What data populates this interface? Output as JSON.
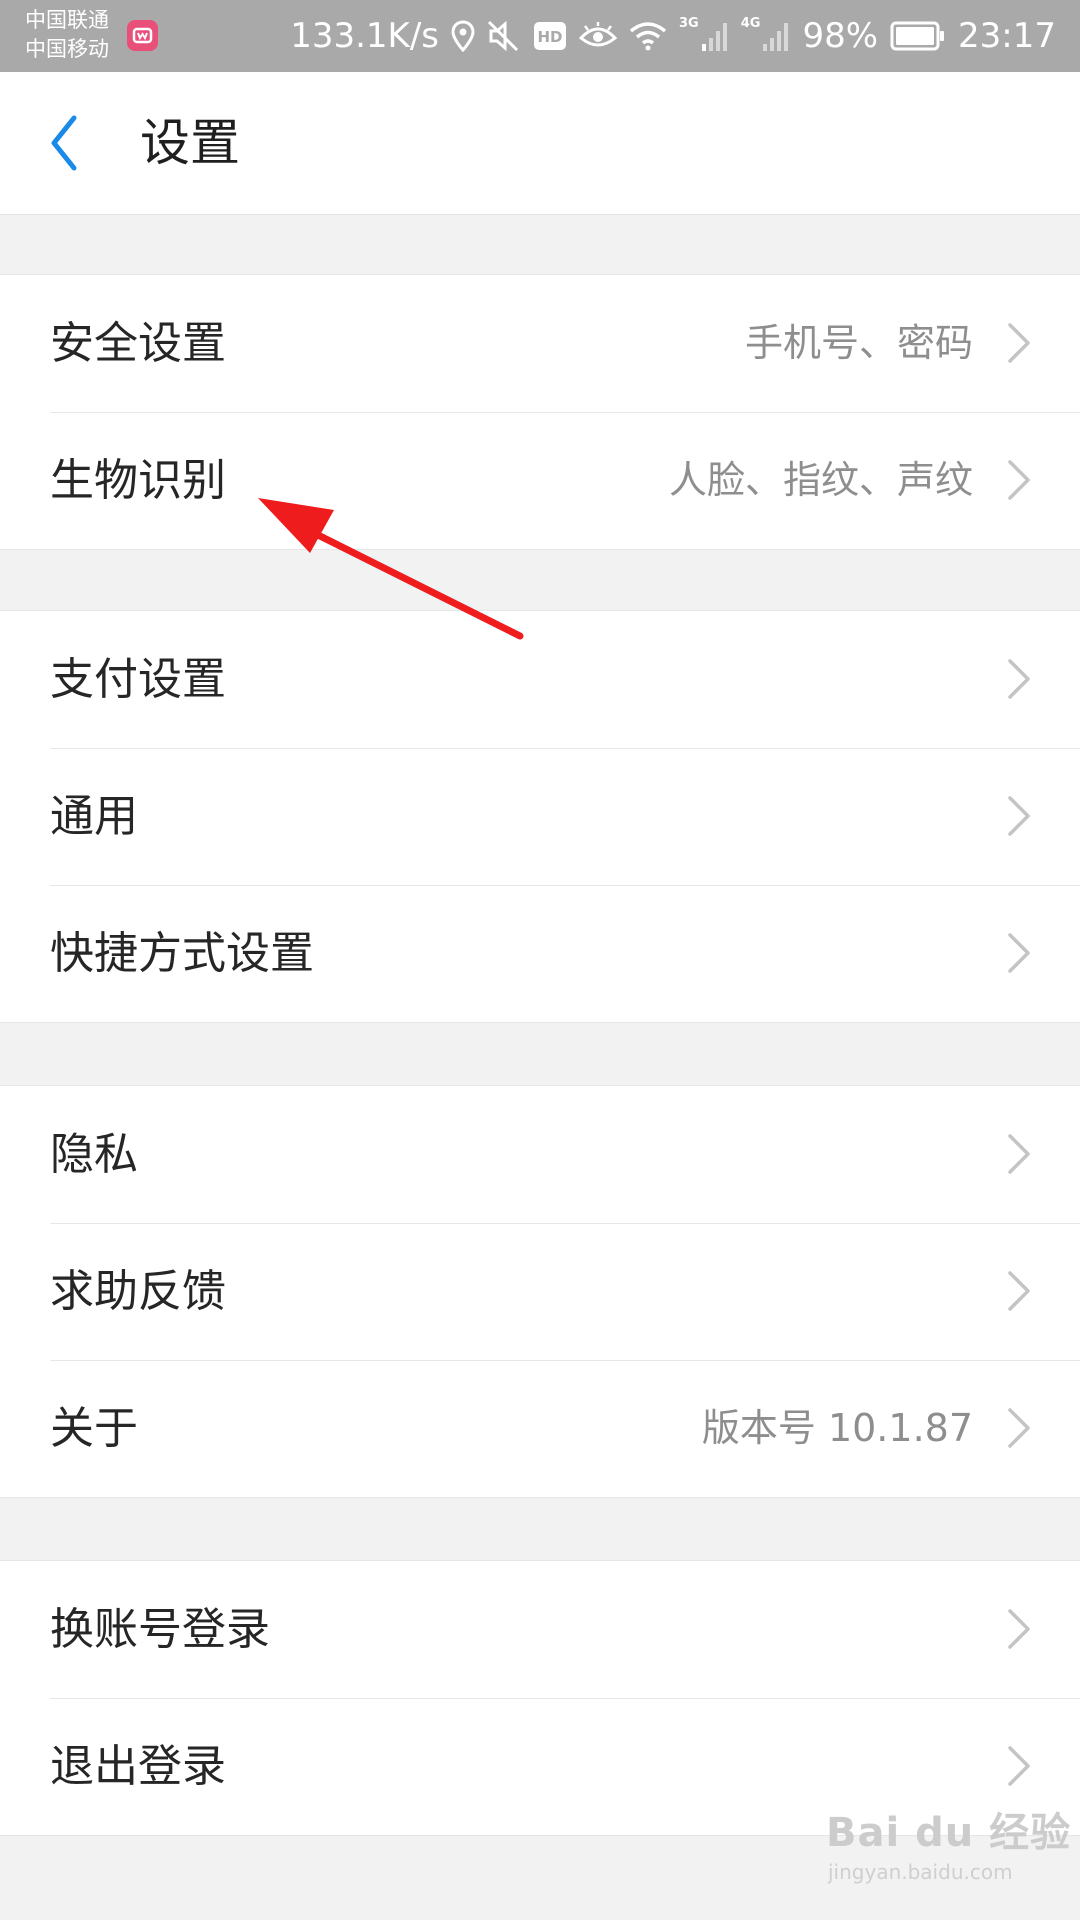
{
  "status_bar": {
    "carrier_1": "中国联通",
    "carrier_2": "中国移动",
    "net_speed": "133.1K/s",
    "hd_label": "HD",
    "sig_3g": "3G",
    "sig_4g": "4G",
    "battery": "98%",
    "time": "23:17",
    "icons": [
      "app-badge-icon",
      "location-icon",
      "mute-icon",
      "hd-icon",
      "eye-icon",
      "wifi-icon",
      "signal-3g-icon",
      "signal-4g-icon",
      "battery-icon"
    ]
  },
  "header": {
    "title": "设置",
    "back_icon": "chevron-left-icon"
  },
  "groups": [
    {
      "items": [
        {
          "label": "安全设置",
          "value": "手机号、密码"
        },
        {
          "label": "生物识别",
          "value": "人脸、指纹、声纹"
        }
      ]
    },
    {
      "items": [
        {
          "label": "支付设置",
          "value": ""
        },
        {
          "label": "通用",
          "value": ""
        },
        {
          "label": "快捷方式设置",
          "value": ""
        }
      ]
    },
    {
      "items": [
        {
          "label": "隐私",
          "value": ""
        },
        {
          "label": "求助反馈",
          "value": ""
        },
        {
          "label": "关于",
          "value": "版本号 10.1.87"
        }
      ]
    },
    {
      "items": [
        {
          "label": "换账号登录",
          "value": ""
        },
        {
          "label": "退出登录",
          "value": ""
        }
      ]
    }
  ],
  "watermark": {
    "logo": "Bai du 经验",
    "url": "jingyan.baidu.com"
  },
  "colors": {
    "status_bar_bg": "#a9a9a9",
    "accent_blue": "#1a8ae8",
    "annotation_red": "#ee1c1c",
    "page_bg": "#f2f2f2"
  }
}
